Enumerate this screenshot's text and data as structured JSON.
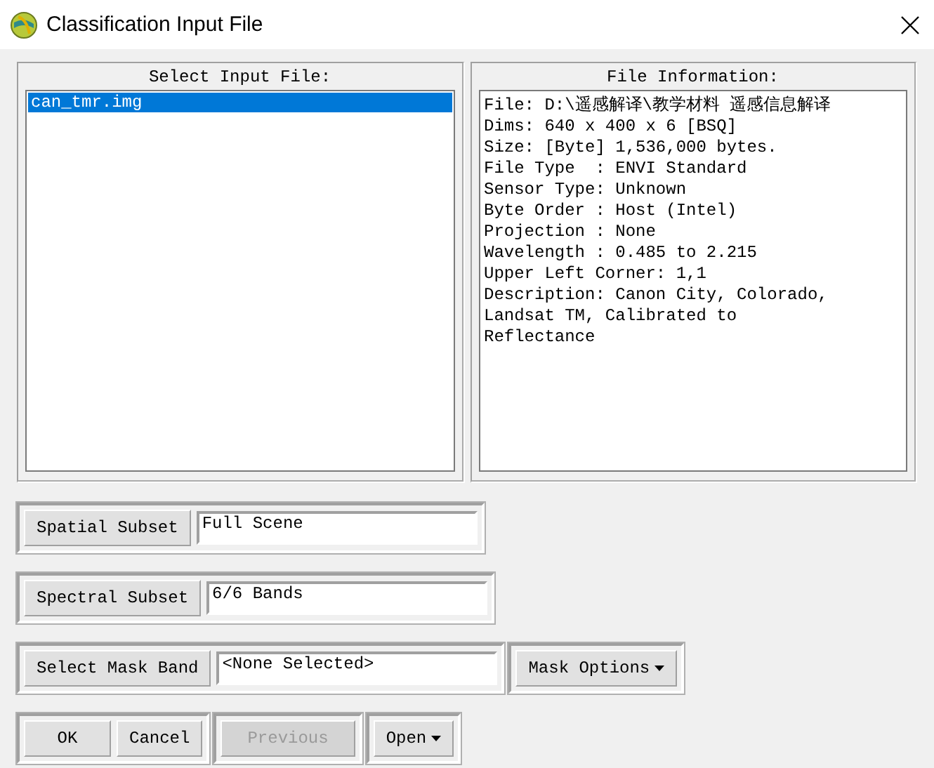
{
  "window": {
    "title": "Classification Input File"
  },
  "input_files": {
    "heading": "Select Input File:",
    "items": [
      {
        "label": "can_tmr.img",
        "selected": true
      }
    ]
  },
  "file_information": {
    "heading": "File Information:",
    "lines": [
      "File: D:\\遥感解译\\教学材料 遥感信息解译",
      "Dims: 640 x 400 x 6 [BSQ]",
      "Size: [Byte] 1,536,000 bytes.",
      "File Type  : ENVI Standard",
      "Sensor Type: Unknown",
      "Byte Order : Host (Intel)",
      "Projection : None",
      "Wavelength : 0.485 to 2.215",
      "Upper Left Corner: 1,1",
      "Description: Canon City, Colorado,",
      "Landsat TM, Calibrated to",
      "Reflectance"
    ]
  },
  "subset_rows": [
    {
      "button": "Spatial Subset",
      "value": "Full Scene"
    },
    {
      "button": "Spectral Subset",
      "value": "6/6 Bands"
    },
    {
      "button": "Select Mask Band",
      "value": "<None Selected>",
      "menu": "Mask Options"
    }
  ],
  "bottom_groups": [
    {
      "buttons": [
        {
          "label": "OK",
          "kind": "plain",
          "disabled": false
        },
        {
          "label": "Cancel",
          "kind": "plain",
          "disabled": false
        }
      ]
    },
    {
      "buttons": [
        {
          "label": "Previous",
          "kind": "plain",
          "disabled": true
        }
      ]
    },
    {
      "buttons": [
        {
          "label": "Open",
          "kind": "menu",
          "disabled": false
        }
      ]
    }
  ]
}
